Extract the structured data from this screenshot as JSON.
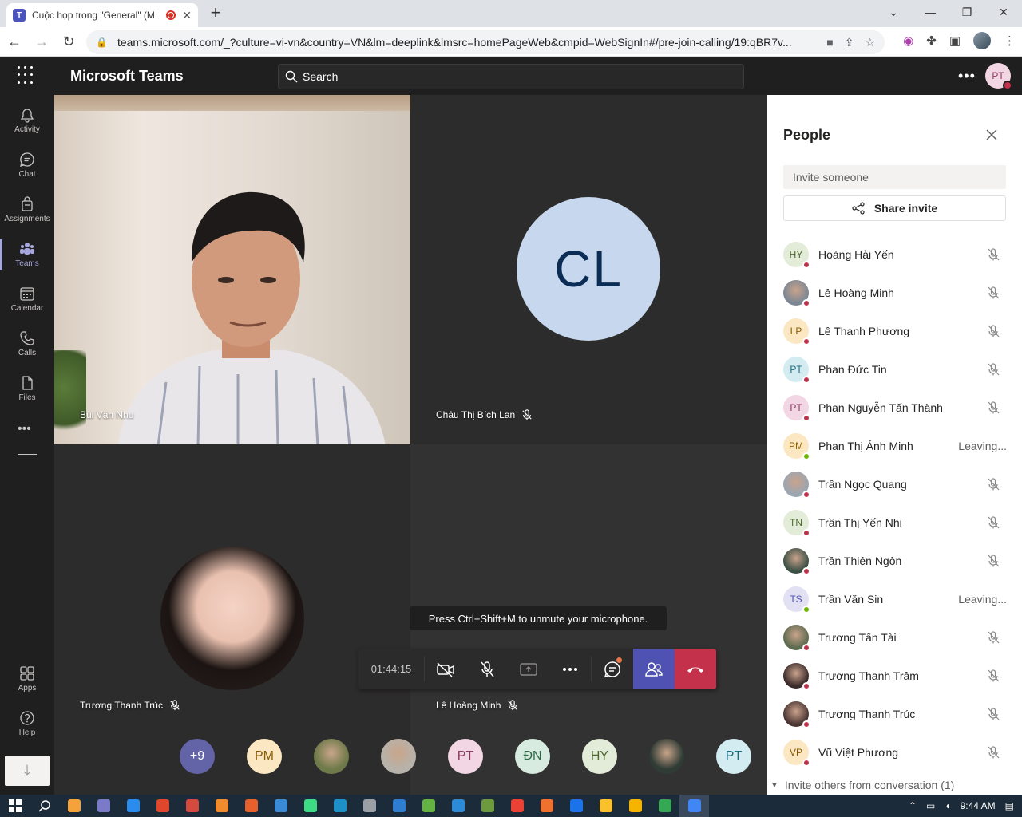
{
  "browser": {
    "tab_title": "Cuộc họp trong \"General\" (M",
    "url": "teams.microsoft.com/_?culture=vi-vn&country=VN&lm=deeplink&lmsrc=homePageWeb&cmpid=WebSignIn#/pre-join-calling/19:qBR7v..."
  },
  "header": {
    "app_name": "Microsoft Teams",
    "search_placeholder": "Search",
    "me_initials": "PT"
  },
  "rail": [
    {
      "label": "Activity",
      "icon": "bell-icon"
    },
    {
      "label": "Chat",
      "icon": "chat-icon"
    },
    {
      "label": "Assignments",
      "icon": "assignments-icon"
    },
    {
      "label": "Teams",
      "icon": "teams-icon",
      "active": true
    },
    {
      "label": "Calendar",
      "icon": "calendar-icon"
    },
    {
      "label": "Calls",
      "icon": "phone-icon"
    },
    {
      "label": "Files",
      "icon": "file-icon"
    }
  ],
  "rail_bottom": [
    {
      "label": "Apps",
      "icon": "apps-icon"
    },
    {
      "label": "Help",
      "icon": "help-icon"
    }
  ],
  "tiles": {
    "video": {
      "name": "Bùi Văn Nhu"
    },
    "cl": {
      "name": "Châu Thị Bích Lan",
      "initials": "CL"
    },
    "ttt": {
      "name": "Trương Thanh Trúc"
    },
    "lhm": {
      "name": "Lê Hoàng Minh"
    }
  },
  "call": {
    "hint": "Press Ctrl+Shift+M to unmute your microphone.",
    "timer": "01:44:15"
  },
  "overflow": [
    {
      "label": "+9",
      "bg": "#6264a7",
      "fg": "#ffffff"
    },
    {
      "label": "PM",
      "bg": "#fbe8c3",
      "fg": "#8a5a00"
    },
    {
      "label": "",
      "bg": "#6f7a4a",
      "fg": "#ffffff",
      "photo": true
    },
    {
      "label": "",
      "bg": "#b7b2aa",
      "fg": "#ffffff",
      "photo": true
    },
    {
      "label": "PT",
      "bg": "#f3d6e4",
      "fg": "#8b3c63"
    },
    {
      "label": "ĐN",
      "bg": "#d7ebe0",
      "fg": "#2d6b45"
    },
    {
      "label": "HY",
      "bg": "#e3ecd8",
      "fg": "#4e6b2f"
    },
    {
      "label": "",
      "bg": "#2f3b35",
      "fg": "#ffffff",
      "photo": true
    },
    {
      "label": "PT",
      "bg": "#d2ecf2",
      "fg": "#1e6b80"
    }
  ],
  "people_panel": {
    "title": "People",
    "invite_placeholder": "Invite someone",
    "share_label": "Share invite",
    "conversation_label": "Invite others from conversation (1)",
    "people": [
      {
        "name": "Hoàng Hải Yến",
        "initials": "HY",
        "bg": "#e3ecd8",
        "fg": "#4e6b2f",
        "status": "muted"
      },
      {
        "name": "Lê Hoàng Minh",
        "initials": "",
        "bg": "#7b8794",
        "fg": "#fff",
        "photo": true,
        "status": "muted"
      },
      {
        "name": "Lê Thanh Phương",
        "initials": "LP",
        "bg": "#fbe8c3",
        "fg": "#8a5a00",
        "status": "muted"
      },
      {
        "name": "Phan Đức Tin",
        "initials": "PT",
        "bg": "#d2ecf2",
        "fg": "#1e6b80",
        "status": "muted"
      },
      {
        "name": "Phan Nguyễn Tấn Thành",
        "initials": "PT",
        "bg": "#f3d6e4",
        "fg": "#8b3c63",
        "status": "muted"
      },
      {
        "name": "Phan Thị Ánh Minh",
        "initials": "PM",
        "bg": "#fbe8c3",
        "fg": "#8a5a00",
        "status": "Leaving...",
        "green": true
      },
      {
        "name": "Trần Ngọc Quang",
        "initials": "",
        "bg": "#9aa6b2",
        "fg": "#fff",
        "photo": true,
        "status": "muted"
      },
      {
        "name": "Trần Thị Yến Nhi",
        "initials": "TN",
        "bg": "#e3ecd8",
        "fg": "#4e6b2f",
        "status": "muted"
      },
      {
        "name": "Trần Thiện Ngôn",
        "initials": "",
        "bg": "#3b5045",
        "fg": "#fff",
        "photo": true,
        "status": "muted"
      },
      {
        "name": "Trần Văn Sin",
        "initials": "TS",
        "bg": "#e2e1f3",
        "fg": "#4f52b2",
        "status": "Leaving...",
        "green": true
      },
      {
        "name": "Trương Tấn Tài",
        "initials": "",
        "bg": "#5d6b4e",
        "fg": "#fff",
        "photo": true,
        "status": "muted"
      },
      {
        "name": "Trương Thanh Trâm",
        "initials": "",
        "bg": "#3a2a2a",
        "fg": "#fff",
        "photo": true,
        "status": "muted"
      },
      {
        "name": "Trương Thanh Trúc",
        "initials": "",
        "bg": "#4a3532",
        "fg": "#fff",
        "photo": true,
        "status": "muted"
      },
      {
        "name": "Vũ Việt Phương",
        "initials": "VP",
        "bg": "#fbe8c3",
        "fg": "#8a5a00",
        "status": "muted"
      }
    ]
  },
  "taskbar": {
    "time": "9:44 AM"
  }
}
